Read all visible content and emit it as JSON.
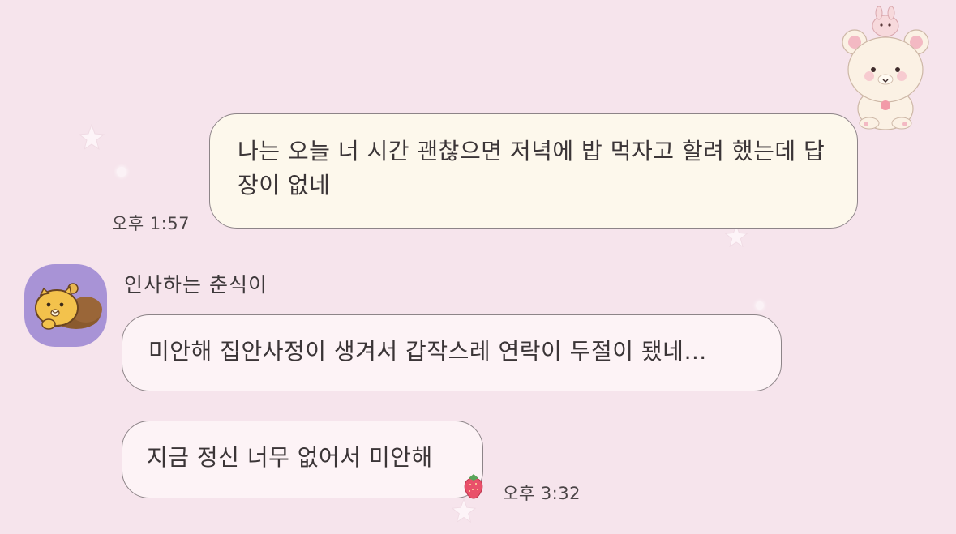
{
  "chat": {
    "messages": [
      {
        "sender": "me",
        "text": "나는 오늘 너 시간 괜찮으면 저녁에 밥 먹자고 할려 했는데 답장이 없네",
        "time": "오후 1:57"
      },
      {
        "sender": "인사하는 춘식이",
        "text": "미안해 집안사정이 생겨서 갑작스레 연락이 두절이 됐네…"
      },
      {
        "sender": "인사하는 춘식이",
        "text": "지금 정신 너무 없어서 미안해",
        "time": "오후 3:32"
      }
    ],
    "contact": {
      "name": "인사하는 춘식이",
      "avatar_icon": "chunsik-cat-avatar-icon"
    }
  },
  "theme": {
    "background": "#f6e4ec",
    "my_bubble": "#fdf8ec",
    "their_bubble": "#fdf3f6",
    "bubble_border": "#8d8488",
    "avatar_bg": "#a893d6",
    "decorations": [
      "rilakkuma-bear-sticker-icon",
      "strawberry-icon",
      "star-icon"
    ]
  }
}
